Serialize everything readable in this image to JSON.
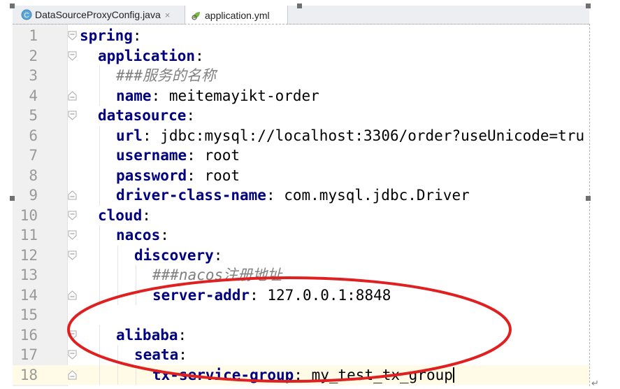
{
  "tabs": [
    {
      "label": "DataSourceProxyConfig.java",
      "close": "×",
      "icon": "java-class-icon",
      "active": false
    },
    {
      "label": "application.yml",
      "icon": "yaml-file-icon",
      "active": true
    }
  ],
  "lines": [
    {
      "num": "1",
      "indent": 0,
      "key": "spring",
      "sep": ":",
      "value": ""
    },
    {
      "num": "2",
      "indent": 1,
      "key": "application",
      "sep": ":",
      "value": ""
    },
    {
      "num": "3",
      "indent": 2,
      "comment": "###服务的名称"
    },
    {
      "num": "4",
      "indent": 2,
      "key": "name",
      "sep": ":",
      "value": " meitemayikt-order"
    },
    {
      "num": "5",
      "indent": 1,
      "key": "datasource",
      "sep": ":",
      "value": ""
    },
    {
      "num": "6",
      "indent": 2,
      "key": "url",
      "sep": ":",
      "value": " jdbc:mysql://localhost:3306/order?useUnicode=tru"
    },
    {
      "num": "7",
      "indent": 2,
      "key": "username",
      "sep": ":",
      "value": " root"
    },
    {
      "num": "8",
      "indent": 2,
      "key": "password",
      "sep": ":",
      "value": " root"
    },
    {
      "num": "9",
      "indent": 2,
      "key": "driver-class-name",
      "sep": ":",
      "value": " com.mysql.jdbc.Driver"
    },
    {
      "num": "10",
      "indent": 1,
      "key": "cloud",
      "sep": ":",
      "value": ""
    },
    {
      "num": "11",
      "indent": 2,
      "key": "nacos",
      "sep": ":",
      "value": ""
    },
    {
      "num": "12",
      "indent": 3,
      "key": "discovery",
      "sep": ":",
      "value": ""
    },
    {
      "num": "13",
      "indent": 4,
      "comment": "###nacos注册地址"
    },
    {
      "num": "14",
      "indent": 4,
      "key": "server-addr",
      "sep": ":",
      "value": " 127.0.0.1:8848"
    },
    {
      "num": "15",
      "indent": 0,
      "blank": true
    },
    {
      "num": "16",
      "indent": 2,
      "key": "alibaba",
      "sep": ":",
      "value": ""
    },
    {
      "num": "17",
      "indent": 3,
      "key": "seata",
      "sep": ":",
      "value": ""
    },
    {
      "num": "18",
      "indent": 4,
      "key": "tx-service-group",
      "sep": ":",
      "value": " my_test_tx_group",
      "current": true
    }
  ],
  "annotation": {
    "shape": "red-ellipse",
    "color": "#e02020"
  },
  "colors": {
    "key": "#000080",
    "comment": "#808080",
    "gutter": "#f0f0f0",
    "current_line": "#fffbe6"
  }
}
